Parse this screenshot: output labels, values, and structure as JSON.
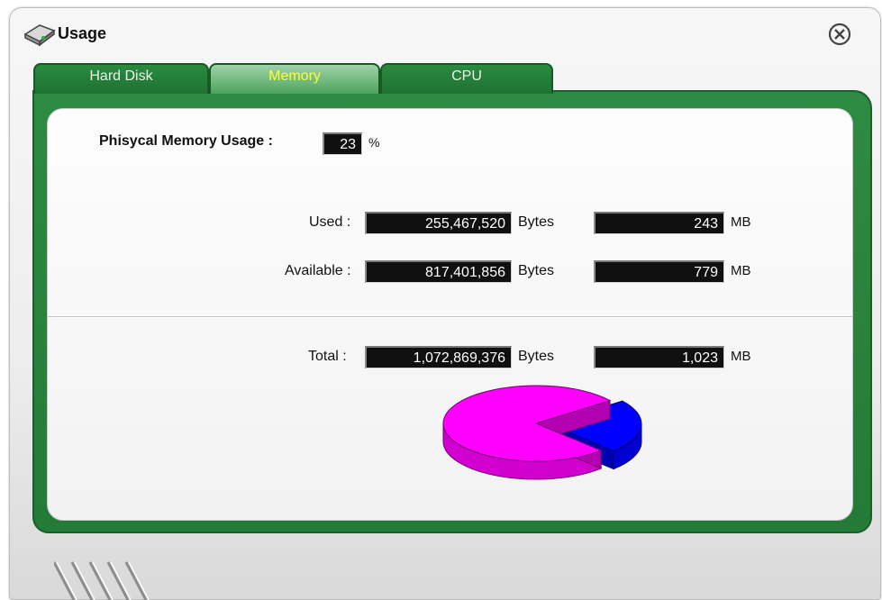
{
  "window": {
    "title": "Usage",
    "close_icon": "close-x-circle-icon",
    "title_icon": "disk-drive-icon"
  },
  "tabs": [
    {
      "label": "Hard Disk",
      "selected": false
    },
    {
      "label": "Memory",
      "selected": true
    },
    {
      "label": "CPU",
      "selected": false
    }
  ],
  "memory": {
    "usage_label": "Phisycal Memory Usage :",
    "usage_value": "23",
    "usage_unit": "%",
    "rows": [
      {
        "label": "Used :",
        "bytes": "255,467,520",
        "bytes_unit": "Bytes",
        "mb": "243",
        "mb_unit": "MB"
      },
      {
        "label": "Available :",
        "bytes": "817,401,856",
        "bytes_unit": "Bytes",
        "mb": "779",
        "mb_unit": "MB"
      }
    ],
    "total": {
      "label": "Total :",
      "bytes": "1,072,869,376",
      "bytes_unit": "Bytes",
      "mb": "1,023",
      "mb_unit": "MB"
    }
  },
  "chart_data": {
    "type": "pie",
    "slices": [
      {
        "value": 23,
        "color": "#0000ff"
      },
      {
        "value": 77,
        "color": "#ff00ff"
      }
    ]
  },
  "colors": {
    "accent_green": "#2f8a43",
    "active_tab_text": "#ffff33",
    "used_slice": "#0000ff",
    "available_slice": "#ff00ff"
  }
}
